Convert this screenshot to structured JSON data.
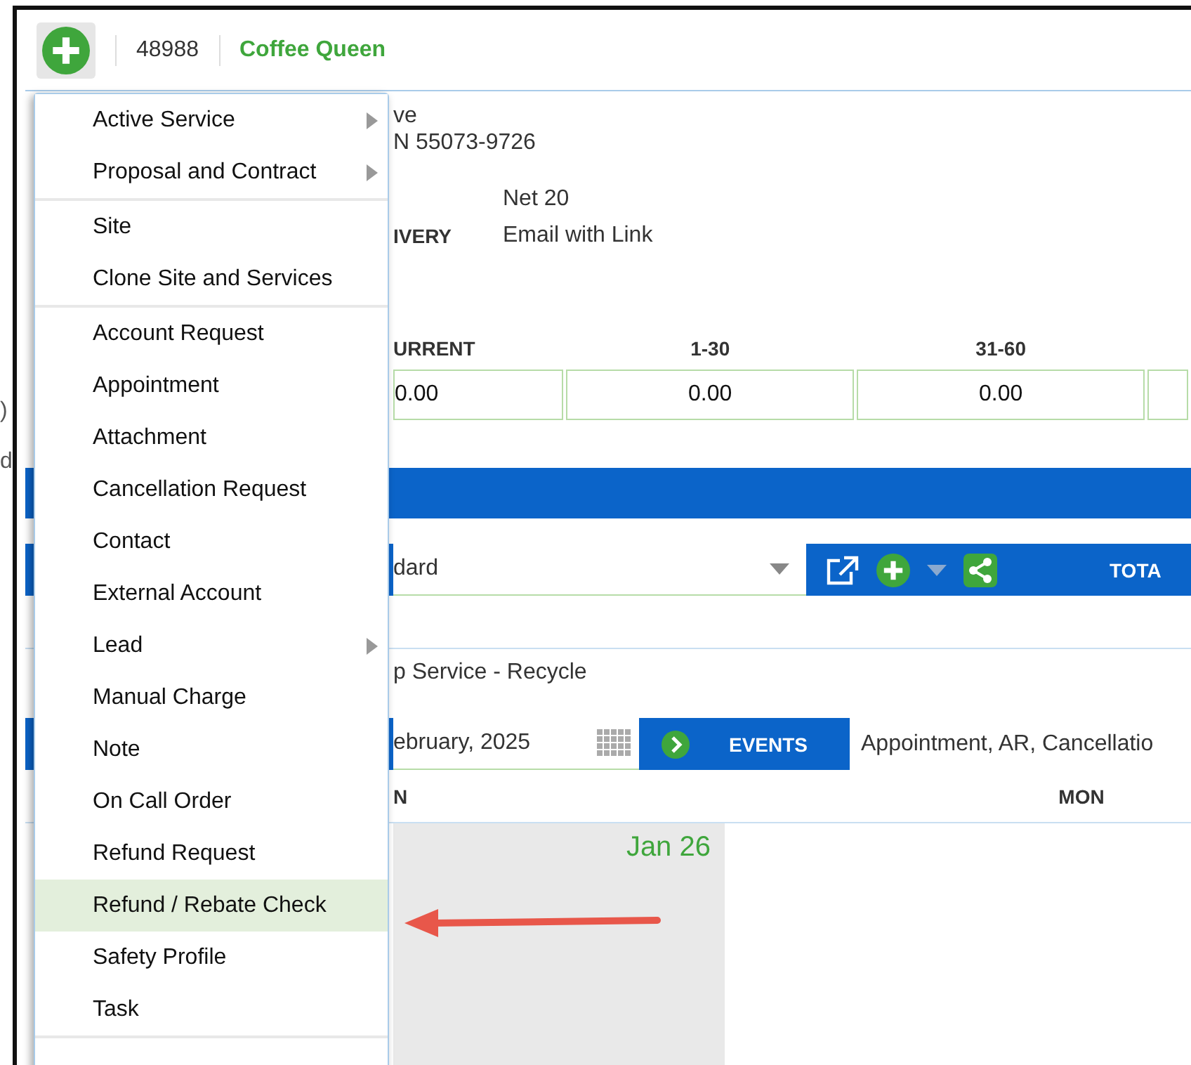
{
  "edge_marks": [
    ")",
    "d"
  ],
  "header": {
    "number": "48988",
    "name": "Coffee Queen"
  },
  "details": {
    "address_lines": [
      "ve",
      "N 55073-9726"
    ],
    "fields": [
      {
        "value": "Net 20"
      },
      {
        "label": "IVERY",
        "value": "Email with Link"
      }
    ]
  },
  "aging": [
    {
      "heading": "URRENT",
      "value": "0.00"
    },
    {
      "heading": "1-30",
      "value": "0.00"
    },
    {
      "heading": "31-60",
      "value": "0.00"
    }
  ],
  "toolbar": {
    "select_value": "dard",
    "total_label": "TOTA"
  },
  "service": "p Service - Recycle",
  "calendar": {
    "date": "ebruary, 2025",
    "events_label": "EVENTS",
    "events_value": "Appointment, AR, Cancellatio",
    "day_headers": [
      "N",
      "MON"
    ],
    "day": "Jan 26"
  },
  "menu": [
    {
      "items": [
        {
          "label": "Active Service",
          "submenu": true,
          "selected": false
        },
        {
          "label": "Proposal and Contract",
          "submenu": true,
          "selected": false
        }
      ]
    },
    {
      "items": [
        {
          "label": "Site",
          "submenu": false,
          "selected": false
        },
        {
          "label": "Clone Site and Services",
          "submenu": false,
          "selected": false
        }
      ]
    },
    {
      "items": [
        {
          "label": "Account Request",
          "submenu": false,
          "selected": false
        },
        {
          "label": "Appointment",
          "submenu": false,
          "selected": false
        },
        {
          "label": "Attachment",
          "submenu": false,
          "selected": false
        },
        {
          "label": "Cancellation Request",
          "submenu": false,
          "selected": false
        },
        {
          "label": "Contact",
          "submenu": false,
          "selected": false
        },
        {
          "label": "External Account",
          "submenu": false,
          "selected": false
        },
        {
          "label": "Lead",
          "submenu": true,
          "selected": false
        },
        {
          "label": "Manual Charge",
          "submenu": false,
          "selected": false
        },
        {
          "label": "Note",
          "submenu": false,
          "selected": false
        },
        {
          "label": "On Call Order",
          "submenu": false,
          "selected": false
        },
        {
          "label": "Refund Request",
          "submenu": false,
          "selected": false
        },
        {
          "label": "Refund / Rebate Check",
          "submenu": false,
          "selected": true
        },
        {
          "label": "Safety Profile",
          "submenu": false,
          "selected": false
        },
        {
          "label": "Task",
          "submenu": false,
          "selected": false
        }
      ]
    }
  ]
}
